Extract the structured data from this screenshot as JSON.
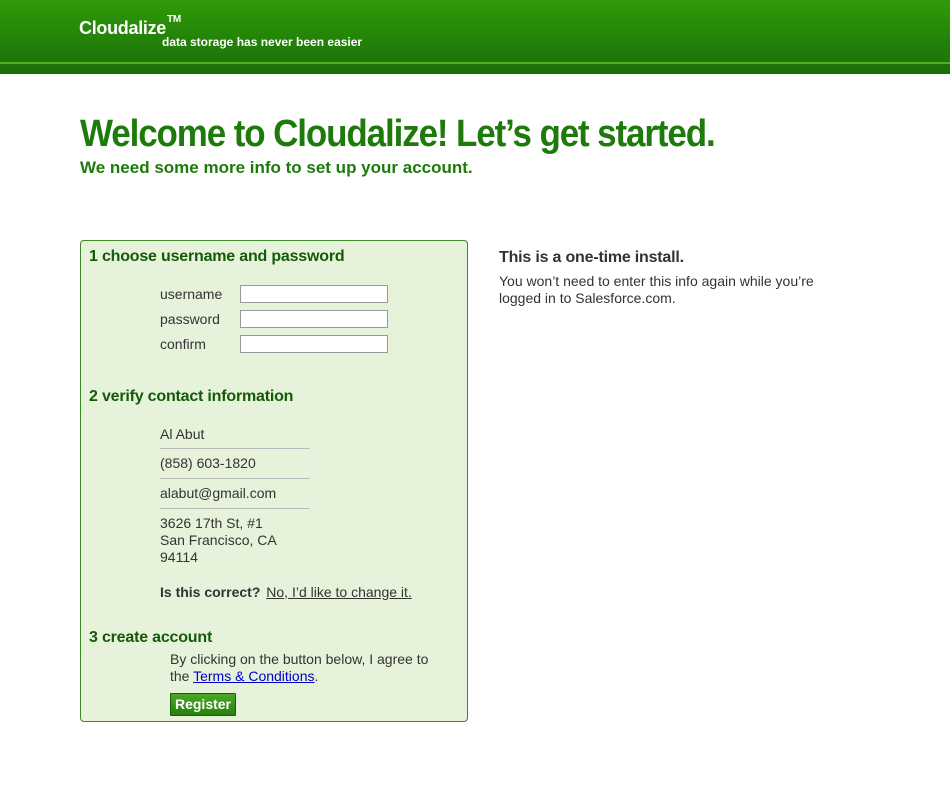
{
  "header": {
    "brand": "Cloudalize",
    "trademark": "TM",
    "tagline": "data storage has never been easier"
  },
  "page": {
    "title": "Welcome to Cloudalize! Let’s get started.",
    "subtitle": "We need some more info to set up your account."
  },
  "form": {
    "step1": {
      "heading": "1 choose username and password",
      "fields": [
        {
          "label": "username",
          "value": ""
        },
        {
          "label": "password",
          "value": ""
        },
        {
          "label": "confirm",
          "value": ""
        }
      ]
    },
    "step2": {
      "heading": "2 verify contact information",
      "name": "Al Abut",
      "phone": "(858) 603-1820",
      "email": "alabut@gmail.com",
      "address_line1": "3626 17th St, #1",
      "address_line2": "San Francisco, CA",
      "address_line3": "94114",
      "question": "Is this correct?",
      "change_link": "No, I’d like to change it."
    },
    "step3": {
      "heading": "3 create account",
      "agree_text_1": "By clicking on the button below, I agree to the",
      "terms_link": "Terms & Conditions",
      "agree_text_2": ".",
      "register_label": "Register"
    }
  },
  "sidebar": {
    "heading": "This is a one-time install.",
    "text": "You won’t need to enter this info again while you’re logged in to Salesforce.com."
  },
  "colors": {
    "brand_green": "#238208",
    "title_green": "#1d7a0b",
    "panel_bg": "#e7f2db",
    "link_blue": "#0000cc"
  }
}
